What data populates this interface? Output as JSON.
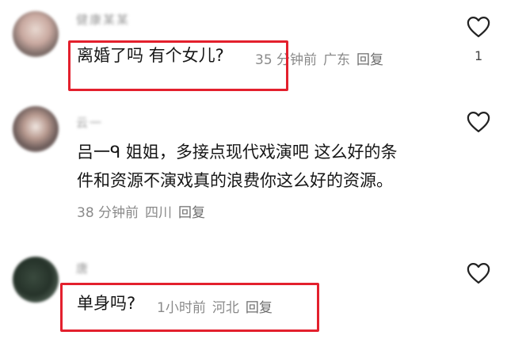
{
  "comments": [
    {
      "username": "健康某某",
      "text": "离婚了吗 有个女儿?",
      "time": "35 分钟前",
      "location": "广东",
      "reply": "回复",
      "likes": "1"
    },
    {
      "username": "云一",
      "text_line1": "吕一ᑫ 姐姐，多接点现代戏演吧 这么好的条",
      "text_line2": "件和资源不演戏真的浪费你这么好的资源。",
      "time": "38 分钟前",
      "location": "四川",
      "reply": "回复",
      "likes": ""
    },
    {
      "username": "唐",
      "text": "单身吗?",
      "time": "1小时前",
      "location": "河北",
      "reply": "回复",
      "likes": ""
    }
  ],
  "icons": {
    "like": "heart-outline-icon"
  },
  "colors": {
    "highlight_box": "#e3202d",
    "meta_text": "#8a8a8a",
    "body_text": "#161616"
  }
}
